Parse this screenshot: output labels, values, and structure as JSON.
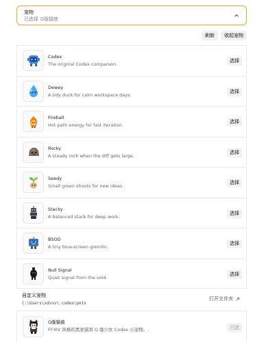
{
  "header": {
    "title": "宠物",
    "selected": "已选择 Q版猫娘"
  },
  "toolbar": {
    "refresh": "刷新",
    "collapse": "收起宠物"
  },
  "pets": [
    {
      "name": "Codex",
      "desc": "The original Codex companion.",
      "action": "选择",
      "icon": "blue-robot-icon"
    },
    {
      "name": "Dewey",
      "desc": "A tidy duck for calm workspace days.",
      "action": "选择",
      "icon": "water-drop-icon"
    },
    {
      "name": "Fireball",
      "desc": "Hot path energy for fast iteration.",
      "action": "选择",
      "icon": "fireball-icon"
    },
    {
      "name": "Rocky",
      "desc": "A steady rock when the diff gets large.",
      "action": "选择",
      "icon": "rock-icon"
    },
    {
      "name": "Seedy",
      "desc": "Small green shoots for new ideas.",
      "action": "选择",
      "icon": "seedling-icon"
    },
    {
      "name": "Stacky",
      "desc": "A balanced stack for deep work.",
      "action": "选择",
      "icon": "stack-robot-icon"
    },
    {
      "name": "BSOD",
      "desc": "A tiny blue-screen gremlin.",
      "action": "选择",
      "icon": "bsod-monitor-icon"
    },
    {
      "name": "Null Signal",
      "desc": "Quiet signal from the void.",
      "action": "选择",
      "icon": "null-signal-icon"
    }
  ],
  "custom": {
    "title": "自定义宠物",
    "path": "C:\\Users\\sdvvv\\.codex\\pets",
    "open_folder": "打开文件夹",
    "pet": {
      "name": "Q版猫娘",
      "desc": "FFXIV 风格的黑发猫耳 Q 版少女 Codex 小宠物。.",
      "action": "已选",
      "icon": "catgirl-icon"
    }
  },
  "colors": {
    "accent_border": "#e8a33a",
    "codex_blue": "#3b7fe0"
  }
}
